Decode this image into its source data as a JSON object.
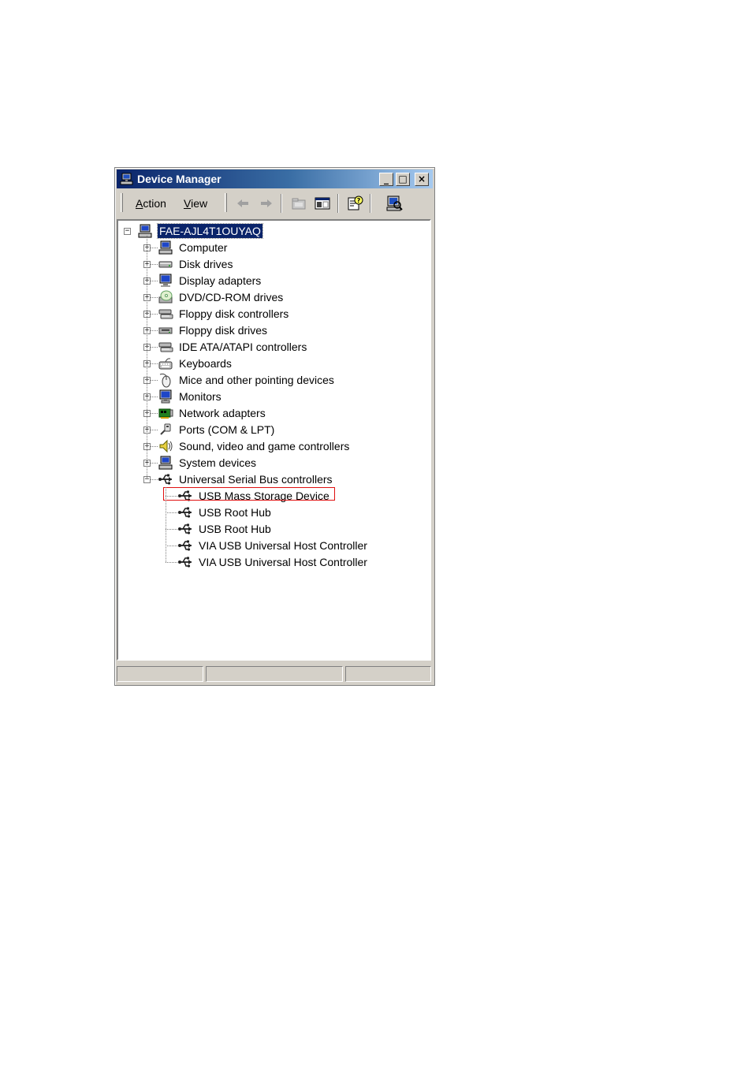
{
  "window": {
    "title": "Device Manager",
    "controls": {
      "minimize": "_",
      "maximize": "□",
      "close": "×"
    }
  },
  "menubar": {
    "action": {
      "accel": "A",
      "rest": "ction"
    },
    "view": {
      "accel": "V",
      "rest": "iew"
    }
  },
  "toolbar": {
    "buttons": [
      "back-arrow-icon",
      "forward-arrow-icon",
      "up-folder-icon",
      "show-hide-tree-icon",
      "properties-help-icon",
      "scan-hardware-icon"
    ]
  },
  "tree": {
    "root": {
      "label": "FAE-AJL4T1OUYAQ",
      "icon": "computer-icon",
      "expanded": true,
      "selected": true
    },
    "categories": [
      {
        "label": "Computer",
        "icon": "computer-icon"
      },
      {
        "label": "Disk drives",
        "icon": "disk-drive-icon"
      },
      {
        "label": "Display adapters",
        "icon": "display-adapter-icon"
      },
      {
        "label": "DVD/CD-ROM drives",
        "icon": "cdrom-icon"
      },
      {
        "label": "Floppy disk controllers",
        "icon": "controller-icon"
      },
      {
        "label": "Floppy disk drives",
        "icon": "floppy-drive-icon"
      },
      {
        "label": "IDE ATA/ATAPI controllers",
        "icon": "controller-icon"
      },
      {
        "label": "Keyboards",
        "icon": "keyboard-icon"
      },
      {
        "label": "Mice and other pointing devices",
        "icon": "mouse-icon"
      },
      {
        "label": "Monitors",
        "icon": "monitor-icon"
      },
      {
        "label": "Network adapters",
        "icon": "network-adapter-icon"
      },
      {
        "label": "Ports (COM & LPT)",
        "icon": "port-icon"
      },
      {
        "label": "Sound, video and game controllers",
        "icon": "speaker-icon"
      },
      {
        "label": "System devices",
        "icon": "computer-icon"
      },
      {
        "label": "Universal Serial Bus controllers",
        "icon": "usb-icon",
        "expanded": true
      }
    ],
    "usb_children": [
      {
        "label": "USB Mass Storage Device",
        "icon": "usb-icon",
        "highlighted": true
      },
      {
        "label": "USB Root Hub",
        "icon": "usb-icon"
      },
      {
        "label": "USB Root Hub",
        "icon": "usb-icon"
      },
      {
        "label": "VIA USB Universal Host Controller",
        "icon": "usb-icon"
      },
      {
        "label": "VIA USB Universal Host Controller",
        "icon": "usb-icon"
      }
    ],
    "expander_collapsed": "+",
    "expander_expanded": "−"
  },
  "colors": {
    "title_gradient_start": "#0a246a",
    "title_gradient_end": "#a6caf0",
    "selection": "#0a246a",
    "highlight_box": "#e01010",
    "face": "#d4d0c8"
  }
}
